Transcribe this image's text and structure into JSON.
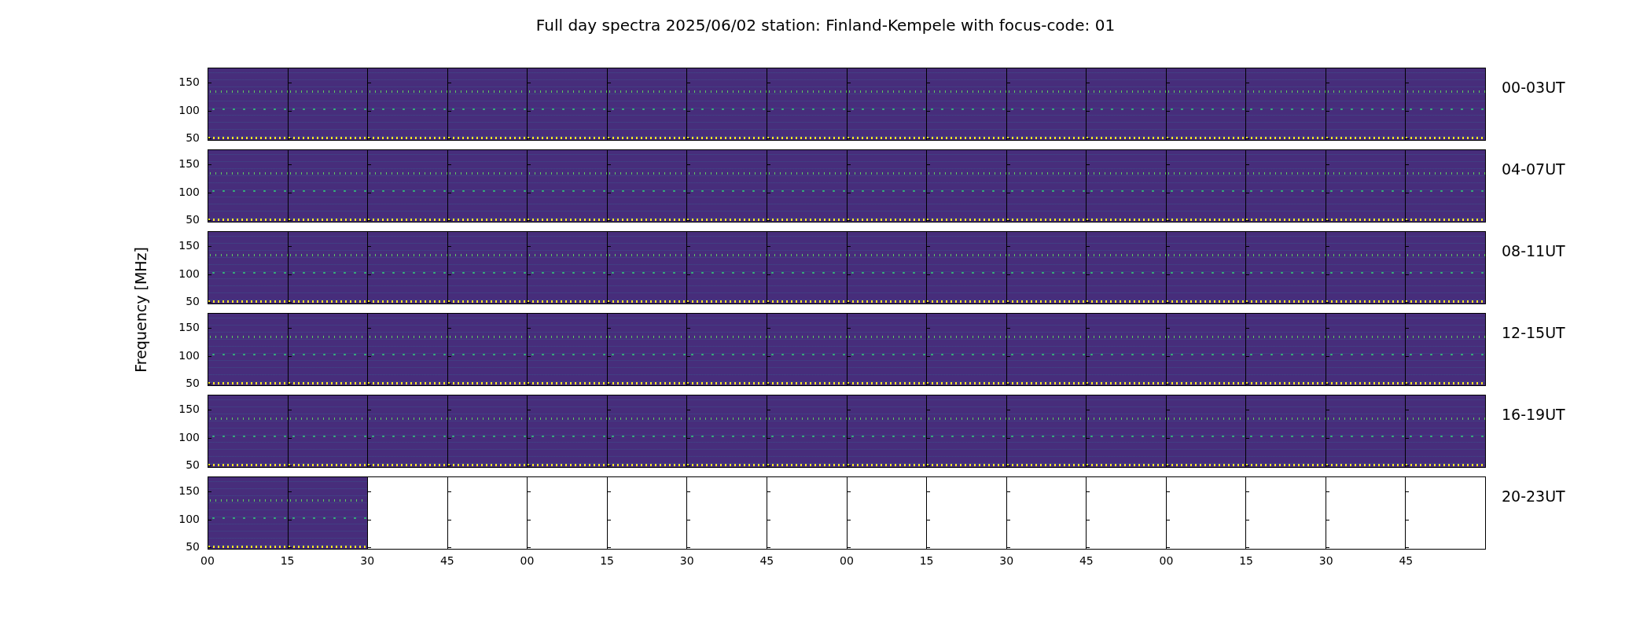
{
  "title": "Full day spectra 2025/06/02 station: Finland-Kempele with focus-code: 01",
  "y_label": "Frequency [MHz]",
  "x_ticks": [
    "00",
    "15",
    "30",
    "45",
    "00",
    "15",
    "30",
    "45",
    "00",
    "15",
    "30",
    "45",
    "00",
    "15",
    "30",
    "45"
  ],
  "rows": [
    {
      "label": "00-03UT",
      "y_ticks": [
        "150",
        "100",
        "50"
      ],
      "panels": [
        true,
        true,
        true,
        true,
        true,
        true,
        true,
        true,
        true,
        true,
        true,
        true,
        true,
        true,
        true,
        true
      ]
    },
    {
      "label": "04-07UT",
      "y_ticks": [
        "150",
        "100",
        "50"
      ],
      "panels": [
        true,
        true,
        true,
        true,
        true,
        true,
        true,
        true,
        true,
        true,
        true,
        true,
        true,
        true,
        true,
        true
      ]
    },
    {
      "label": "08-11UT",
      "y_ticks": [
        "150",
        "100",
        "50"
      ],
      "panels": [
        true,
        true,
        true,
        true,
        true,
        true,
        true,
        true,
        true,
        true,
        true,
        true,
        true,
        true,
        true,
        true
      ]
    },
    {
      "label": "12-15UT",
      "y_ticks": [
        "150",
        "100",
        "50"
      ],
      "panels": [
        true,
        true,
        true,
        true,
        true,
        true,
        true,
        true,
        true,
        true,
        true,
        true,
        true,
        true,
        true,
        true
      ]
    },
    {
      "label": "16-19UT",
      "y_ticks": [
        "150",
        "100",
        "50"
      ],
      "panels": [
        true,
        true,
        true,
        true,
        true,
        true,
        true,
        true,
        true,
        true,
        true,
        true,
        true,
        true,
        true,
        true
      ]
    },
    {
      "label": "20-23UT",
      "y_ticks": [
        "150",
        "100",
        "50"
      ],
      "panels": [
        true,
        true,
        false,
        false,
        false,
        false,
        false,
        false,
        false,
        false,
        false,
        false,
        false,
        false,
        false,
        false
      ]
    }
  ]
}
